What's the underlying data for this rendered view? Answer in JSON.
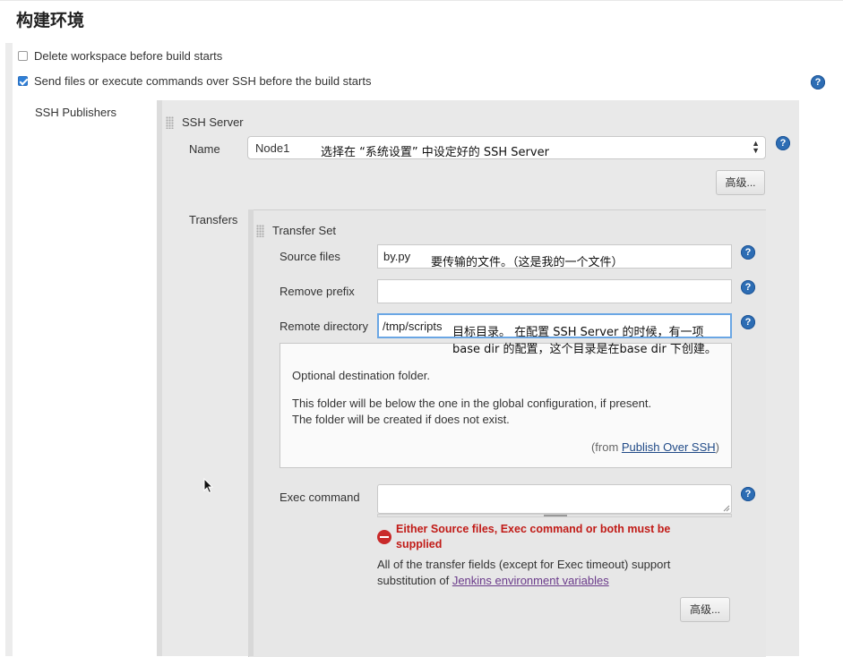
{
  "section": {
    "title": "构建环境"
  },
  "options": [
    {
      "label": "Delete workspace before build starts",
      "checked": false
    },
    {
      "label": "Send files or execute commands over SSH before the build starts",
      "checked": true
    }
  ],
  "ssh_publishers": {
    "label": "SSH Publishers",
    "server_header": "SSH Server",
    "name_label": "Name",
    "name_value": "Node1",
    "name_annotation": "选择在 “系统设置” 中设定好的 SSH Server",
    "advanced_label": "高级...",
    "transfers_label": "Transfers",
    "transfer_set": {
      "header": "Transfer Set",
      "source_files_label": "Source files",
      "source_files_value": "by.py",
      "source_files_annotation": "要传输的文件。（这是我的一个文件）",
      "remove_prefix_label": "Remove prefix",
      "remove_prefix_value": "",
      "remote_directory_label": "Remote directory",
      "remote_directory_value": "/tmp/scripts",
      "remote_directory_annotation_line1": "目标目录。 在配置 SSH Server 的时候，有一项",
      "remote_directory_annotation_line2": "base dir 的配置，这个目录是在base dir 下创建。",
      "help": {
        "line1": "Optional destination folder.",
        "line2": "This folder will be below the one in the global configuration, if present.",
        "line3": "The folder will be created if does not exist.",
        "from_prefix": "(from ",
        "from_link": "Publish Over SSH",
        "from_suffix": ")"
      },
      "exec_command_label": "Exec command",
      "exec_command_value": "",
      "error_line1": "Either Source files, Exec command or both must be",
      "error_line2": "supplied",
      "info_line1": "All of the transfer fields (except for Exec timeout) support",
      "info_prefix": "substitution of ",
      "info_link": "Jenkins environment variables",
      "advanced_label": "高级..."
    }
  },
  "help_icon_glyph": "?",
  "icons": [
    "checkbox",
    "help-icon",
    "drag-handle-icon",
    "select-arrow-icon",
    "error-icon",
    "textarea-resize-icon",
    "mouse-cursor-icon"
  ],
  "colors": {
    "accent": "#2d6db4",
    "error": "#c11b17",
    "panel": "#e9e9e9",
    "focus": "#6aa6e4"
  }
}
